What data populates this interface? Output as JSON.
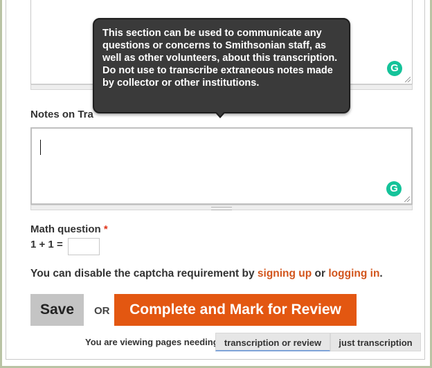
{
  "tooltip": {
    "text": "This section can be used to communicate any questions or concerns to Smithsonian staff, as well as other volunteers, about this transcription. Do not use to transcribe extraneous notes made by collector or other institutions."
  },
  "notes_label": "Notes on Tra",
  "math": {
    "label": "Math question",
    "required_mark": "*",
    "expression": "1 + 1 =",
    "answer_value": ""
  },
  "captcha": {
    "prefix": "You can disable the captcha requirement by ",
    "signup_link": "signing up",
    "middle": " or ",
    "login_link": "logging in",
    "suffix": "."
  },
  "actions": {
    "save_label": "Save",
    "or_label": "OR",
    "review_label": "Complete and Mark for Review"
  },
  "filter": {
    "viewing_text": "You are viewing pages needing",
    "tab_active": "transcription or review",
    "tab_other": "just transcription"
  },
  "icons": {
    "grammarly": "grammarly-icon",
    "resize": "resize-handle-icon"
  },
  "colors": {
    "accent_orange": "#e35711",
    "link_orange": "#d2551c",
    "required_red": "#e0341a",
    "grammarly_green": "#15c39a",
    "tooltip_bg": "#3a3a3a"
  }
}
